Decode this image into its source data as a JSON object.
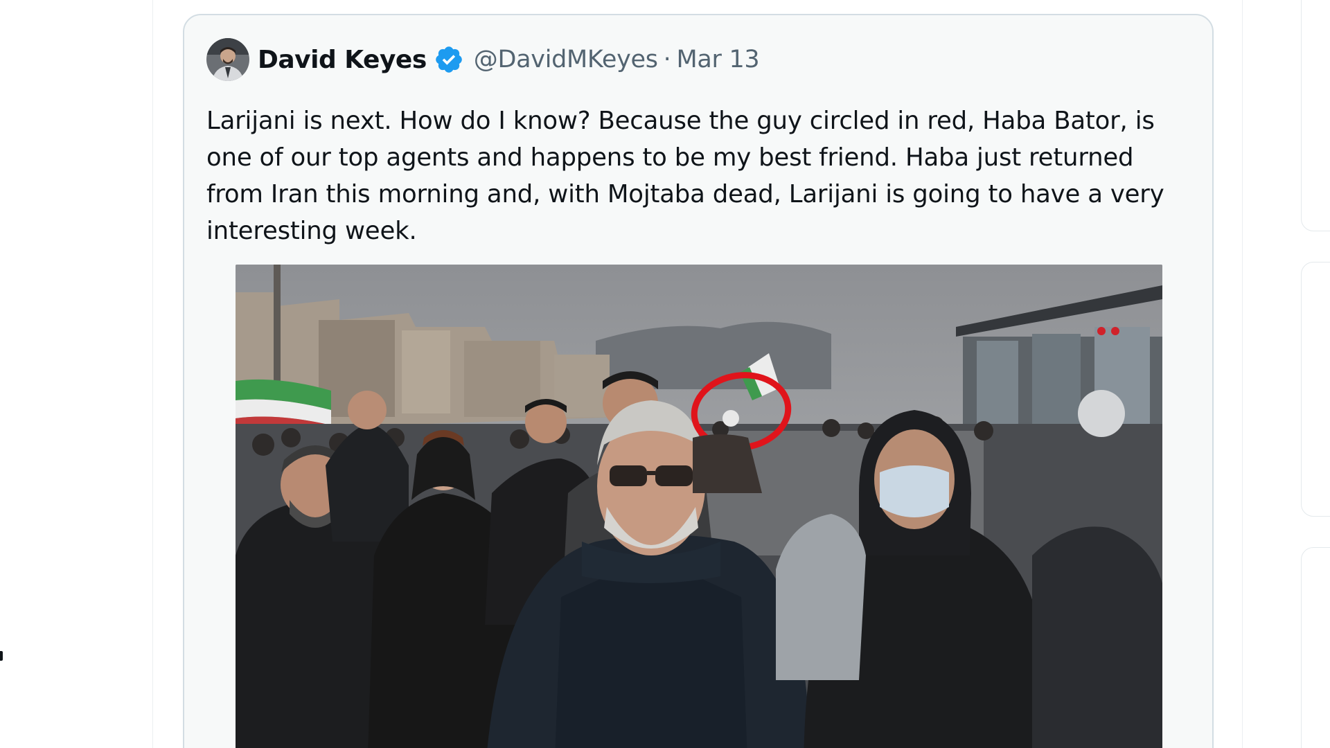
{
  "quote_tweet": {
    "author_name": "David Keyes",
    "author_handle": "@DavidMKeyes",
    "separator": "·",
    "date": "Mar 13",
    "text": "Larijani is next. How do I know? Because the guy circled in red, Haba Bator, is one of our top agents and happens to be my best friend. Haba just returned from Iran this morning and, with Mojtaba dead, Larijani is going to have a very interesting week.",
    "avatar_icon": "avatar-photo",
    "verified_icon": "verified-badge-icon",
    "media": {
      "kind": "photo",
      "annotation_color": "#e0141b"
    }
  },
  "colors": {
    "card_background": "#f7f9f9",
    "card_border": "#d3dde3",
    "primary_text": "#0f1419",
    "secondary_text": "#536471",
    "verified_blue": "#1d9bf0"
  }
}
